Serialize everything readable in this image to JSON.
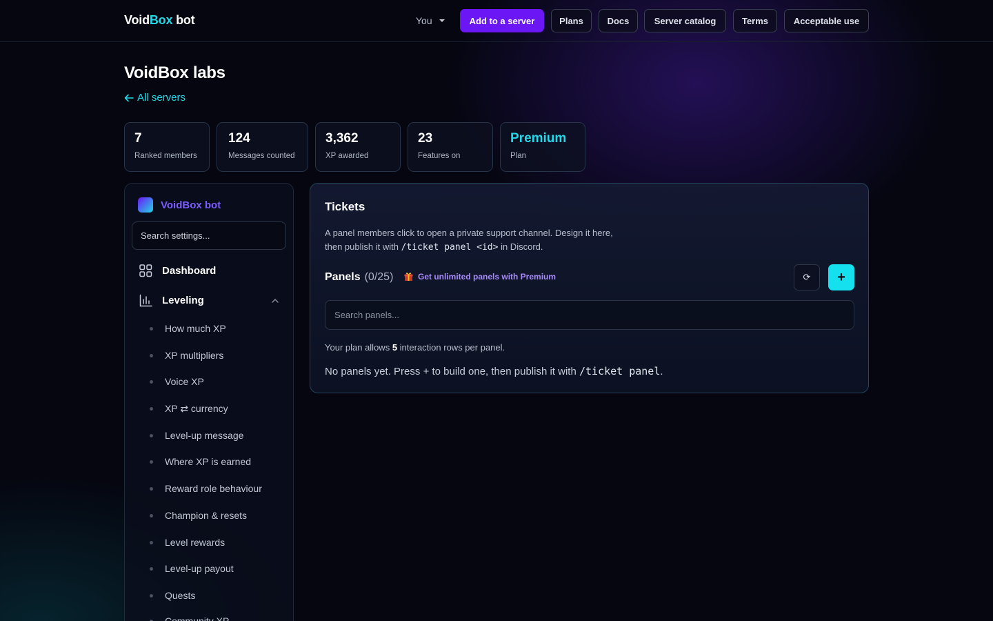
{
  "nav": {
    "brand_main": "VoidBox bot",
    "brand_void": "Void",
    "brand_box": "Box",
    "brand_bot": " bot",
    "user_menu": "You",
    "buttons": [
      "Add to a server",
      "Plans",
      "Docs",
      "Server catalog",
      "Terms",
      "Acceptable use"
    ]
  },
  "header": {
    "title": "VoidBox labs",
    "back_link": "All servers"
  },
  "stats": [
    {
      "value": "7",
      "label": "Ranked members"
    },
    {
      "value": "124",
      "label": "Messages counted"
    },
    {
      "value": "3,362",
      "label": "XP awarded"
    },
    {
      "value": "23",
      "label": "Features on"
    },
    {
      "value": "Premium",
      "label": "Plan"
    }
  ],
  "sidebar": {
    "brand": "VoidBox bot",
    "search_placeholder": "Search settings...",
    "dashboard": "Dashboard",
    "leveling": "Leveling",
    "subitems": [
      "How much XP",
      "XP multipliers",
      "Voice XP",
      "XP ⇄ currency",
      "Level-up message",
      "Where XP is earned",
      "Reward role behaviour",
      "Champion & resets",
      "Level rewards",
      "Level-up payout",
      "Quests",
      "Community XP"
    ]
  },
  "tickets": {
    "title": "Tickets",
    "desc_1": "A panel members click to open a private support channel. Design it here,",
    "desc_2a": "then publish it with ",
    "desc_2_code": "/ticket panel <id>",
    "desc_2b": " in Discord.",
    "panels_label": "Panels",
    "panels_count": "(0/25)",
    "promo": "Get unlimited panels with Premium",
    "refresh_glyph": "⟳",
    "add_glyph": "+",
    "search_placeholder": "Search panels...",
    "plan_a": "Your plan allows ",
    "plan_rows": "5",
    "plan_b": " interaction rows per panel.",
    "empty_a": "No panels yet. Press + to build one, then publish it with ",
    "empty_code": "/ticket panel",
    "empty_b": "."
  },
  "colors": {
    "accent_cyan": "#22d8e8",
    "accent_purple": "#6a16f5",
    "background": "#050610"
  }
}
